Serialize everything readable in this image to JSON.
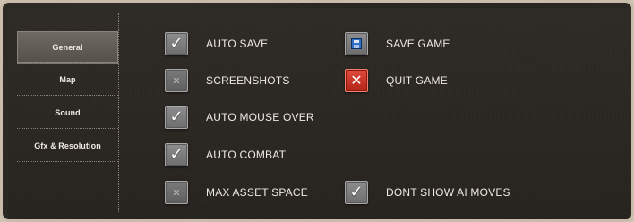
{
  "menu": {
    "items": [
      {
        "label": "General",
        "active": true
      },
      {
        "label": "Map",
        "active": false
      },
      {
        "label": "Sound",
        "active": false
      },
      {
        "label": "Gfx & Resolution",
        "active": false
      }
    ]
  },
  "options": {
    "auto_save": {
      "label": "AUTO SAVE",
      "checked": true
    },
    "screenshots": {
      "label": "SCREENSHOTS",
      "checked": false
    },
    "auto_mouse_over": {
      "label": "AUTO MOUSE OVER",
      "checked": true
    },
    "auto_combat": {
      "label": "AUTO COMBAT",
      "checked": true
    },
    "max_asset_space": {
      "label": "MAX ASSET SPACE",
      "checked": false
    },
    "dont_show_ai_moves": {
      "label": "DONT SHOW AI MOVES",
      "checked": true
    }
  },
  "actions": {
    "save_game": {
      "label": "SAVE GAME",
      "icon": "floppy-disk-icon"
    },
    "quit_game": {
      "label": "QUIT GAME",
      "icon": "close-x-icon"
    }
  },
  "glyphs": {
    "check": "✓",
    "x_small": "✕",
    "x_big": "✕"
  },
  "colors": {
    "danger": "#c73324",
    "save_icon": "#2f6fc4",
    "text": "#efe9e2"
  }
}
